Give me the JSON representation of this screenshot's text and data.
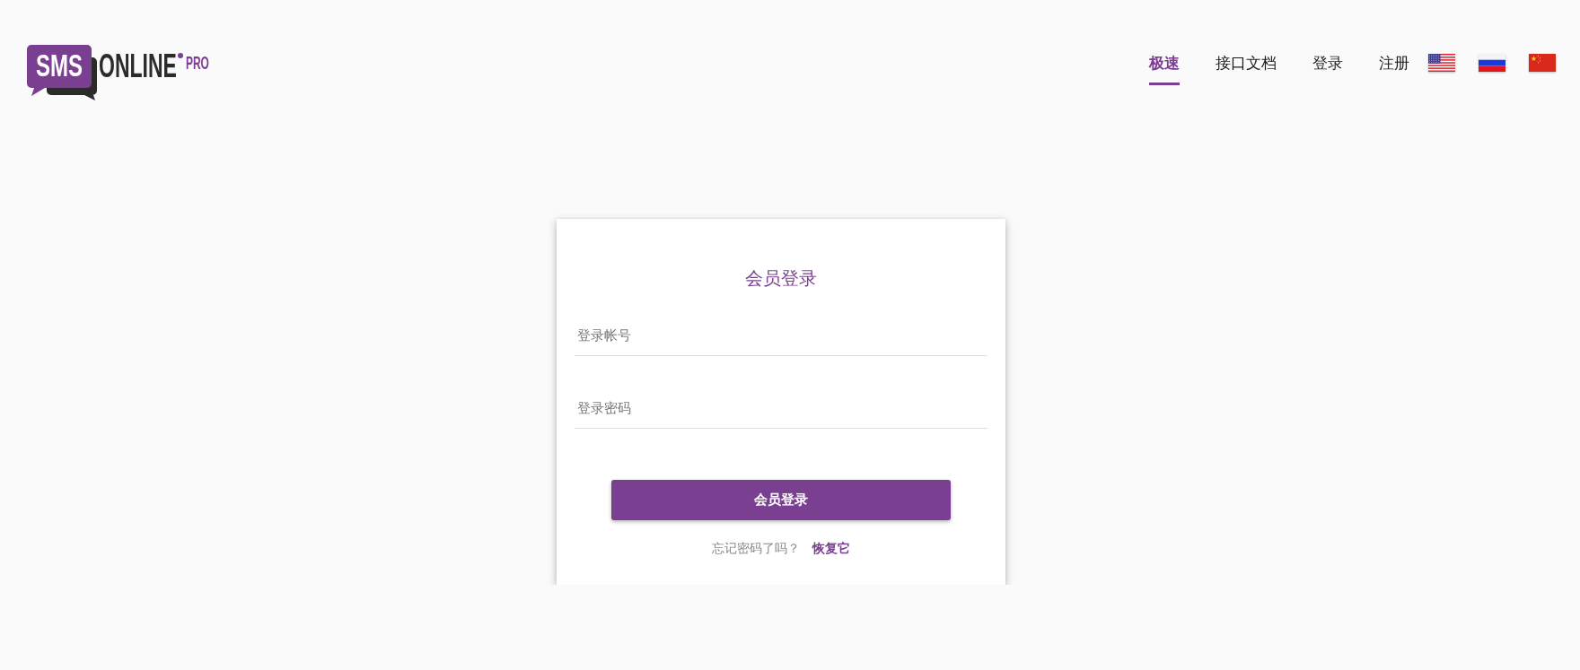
{
  "logo": {
    "brand": "SMS",
    "name": "ONLINE",
    "suffix": "PRO"
  },
  "nav": {
    "links": [
      {
        "label": "极速",
        "selected": true
      },
      {
        "label": "接口文档",
        "selected": false
      },
      {
        "label": "登录",
        "selected": false
      },
      {
        "label": "注册",
        "selected": false
      }
    ],
    "languages": [
      {
        "kind": "usa"
      },
      {
        "kind": "russia"
      },
      {
        "kind": "china"
      }
    ]
  },
  "login_card": {
    "title": "会员登录",
    "fields": [
      {
        "placeholder": "登录帐号"
      },
      {
        "placeholder": "登录密码"
      }
    ],
    "submit_button": "会员登录",
    "forgot_password": {
      "prompt": "忘记密码了吗？",
      "link": "恢复它"
    }
  }
}
